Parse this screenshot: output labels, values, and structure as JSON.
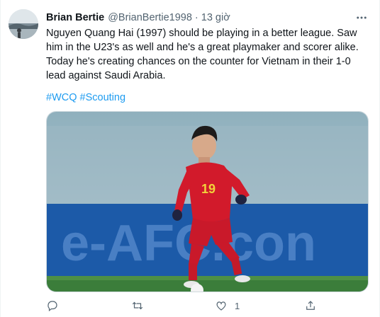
{
  "tweet": {
    "display_name": "Brian Bertie",
    "handle": "@BrianBertie1998",
    "separator": "·",
    "time": "13 giờ",
    "text": "Nguyen Quang Hai (1997) should be playing in a better league. Saw him in the U23's as well and he's a great playmaker and scorer alike. Today he's creating chances on the counter for Vietnam in their 1-0 lead against Saudi Arabia.",
    "hashtags": [
      "#WCQ",
      "#Scouting"
    ],
    "media": {
      "banner_text": "e-AFC.con",
      "jersey_number": "19"
    },
    "actions": {
      "reply_icon": "reply-icon",
      "retweet_icon": "retweet-icon",
      "like_icon": "heart-icon",
      "share_icon": "share-icon",
      "like_count": "1"
    }
  },
  "colors": {
    "accent": "#1d9bf0",
    "text": "#0f1419",
    "secondary": "#536471"
  }
}
